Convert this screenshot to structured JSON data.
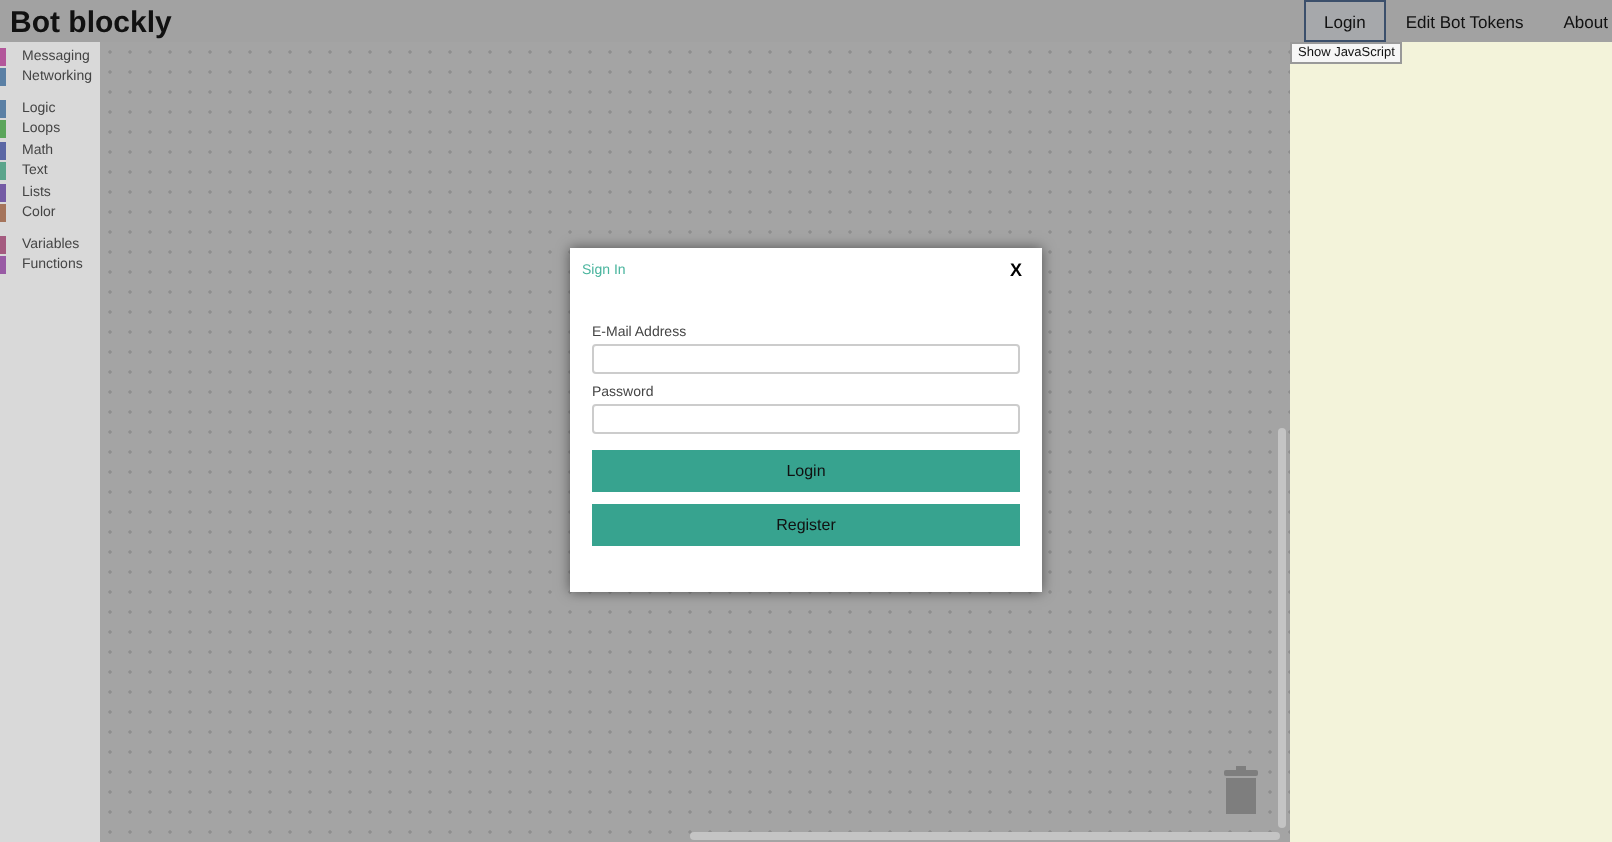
{
  "app_title": "Bot blockly",
  "nav": [
    {
      "label": "Login",
      "selected": true
    },
    {
      "label": "Edit Bot Tokens",
      "selected": false
    },
    {
      "label": "About",
      "selected": false
    }
  ],
  "tooltip": "Show JavaScript",
  "toolbox": [
    [
      {
        "label": "Messaging",
        "color": "#b3579b"
      },
      {
        "label": "Networking",
        "color": "#5b80a5"
      }
    ],
    [
      {
        "label": "Logic",
        "color": "#5b80a5"
      },
      {
        "label": "Loops",
        "color": "#5ba55b"
      },
      {
        "label": "Math",
        "color": "#5b67a5"
      },
      {
        "label": "Text",
        "color": "#5ba58c"
      },
      {
        "label": "Lists",
        "color": "#745ba5"
      },
      {
        "label": "Color",
        "color": "#a5745b"
      }
    ],
    [
      {
        "label": "Variables",
        "color": "#a55b80"
      },
      {
        "label": "Functions",
        "color": "#995ba5"
      }
    ]
  ],
  "dialog": {
    "title": "Sign In",
    "close": "X",
    "fields": [
      {
        "label": "E-Mail Address"
      },
      {
        "label": "Password"
      }
    ],
    "buttons": [
      "Login",
      "Register"
    ]
  }
}
